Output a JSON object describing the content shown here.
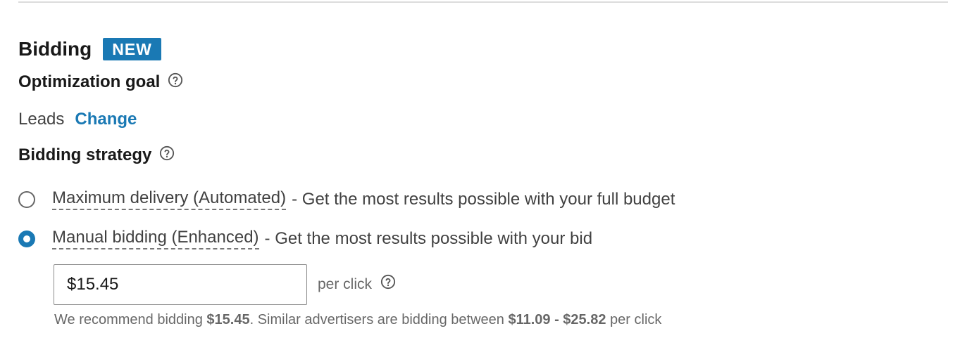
{
  "section": {
    "title": "Bidding",
    "badge": "NEW"
  },
  "optimization_goal": {
    "label": "Optimization goal",
    "value": "Leads",
    "change_label": "Change"
  },
  "bidding_strategy": {
    "label": "Bidding strategy",
    "options": [
      {
        "title": "Maximum delivery (Automated)",
        "description": "- Get the most results possible with your full budget",
        "selected": false
      },
      {
        "title": "Manual bidding (Enhanced)",
        "description": "- Get the most results possible with your bid",
        "selected": true
      }
    ]
  },
  "bid": {
    "value": "$15.45",
    "unit_label": "per click"
  },
  "recommendation": {
    "prefix": "We recommend bidding",
    "recommended_bid": "$15.45",
    "middle": ". Similar advertisers are bidding between",
    "range": "$11.09 - $25.82",
    "suffix": "per click"
  },
  "colors": {
    "accent": "#1a79b4",
    "divider": "#dcdcdc"
  },
  "icons": {
    "help": "question-circle-icon"
  }
}
